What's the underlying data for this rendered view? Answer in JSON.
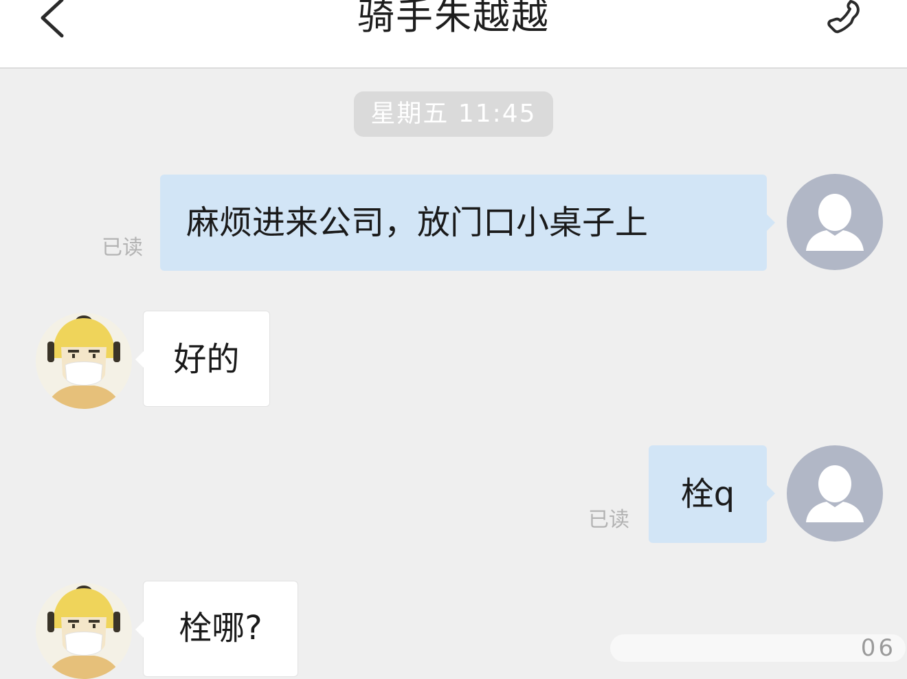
{
  "header": {
    "title": "骑手朱越越",
    "back_icon": "chevron-left-icon",
    "call_icon": "phone-icon"
  },
  "timestamp": "星期五 11:45",
  "messages": [
    {
      "sender": "me",
      "text": "麻烦进来公司，放门口小桌子上",
      "status": "已读"
    },
    {
      "sender": "rider",
      "text": "好的"
    },
    {
      "sender": "me",
      "text": "栓q",
      "status": "已读"
    },
    {
      "sender": "rider",
      "text": "栓哪?"
    }
  ],
  "watermark": "06",
  "colors": {
    "background": "#efefef",
    "outgoing_bubble": "#d2e5f6",
    "incoming_bubble": "#ffffff",
    "self_avatar": "#b1b7c6",
    "timestamp_chip": "#dadada"
  }
}
